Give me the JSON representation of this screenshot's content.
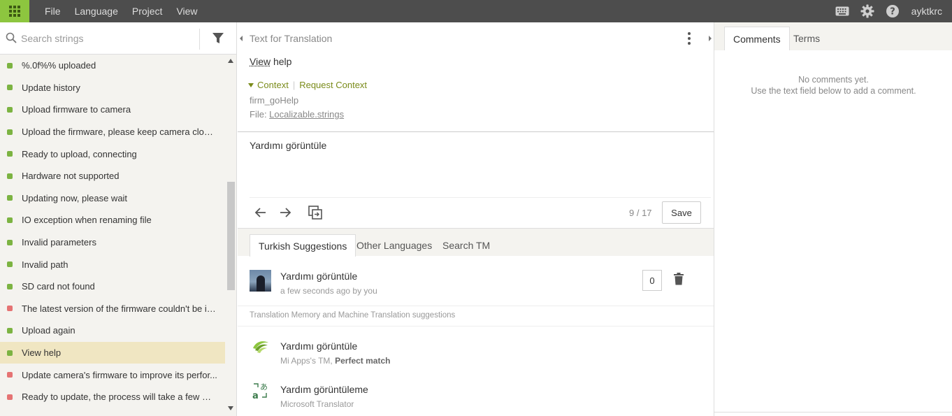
{
  "topbar": {
    "menu": [
      "File",
      "Language",
      "Project",
      "View"
    ],
    "user": "ayktkrc",
    "icons": [
      "apps-grid-icon",
      "keyboard-icon",
      "gear-icon",
      "help-icon"
    ]
  },
  "search": {
    "placeholder": "Search strings"
  },
  "strings": [
    {
      "label": "%.0f%% uploaded",
      "status": "translated"
    },
    {
      "label": "Update history",
      "status": "translated"
    },
    {
      "label": "Upload firmware to camera",
      "status": "translated"
    },
    {
      "label": "Upload the firmware, please keep camera close t...",
      "status": "translated"
    },
    {
      "label": "Ready to upload, connecting",
      "status": "translated"
    },
    {
      "label": "Hardware not supported",
      "status": "translated"
    },
    {
      "label": "Updating now, please wait",
      "status": "translated"
    },
    {
      "label": "IO exception when renaming file",
      "status": "translated"
    },
    {
      "label": "Invalid parameters",
      "status": "translated"
    },
    {
      "label": "Invalid path",
      "status": "translated"
    },
    {
      "label": "SD card not found",
      "status": "translated"
    },
    {
      "label": "The latest version of the firmware couldn't be inst...",
      "status": "untranslated"
    },
    {
      "label": "Upload again",
      "status": "translated"
    },
    {
      "label": "View help",
      "status": "translated"
    },
    {
      "label": "Update camera's firmware to improve its perfor...",
      "status": "untranslated"
    },
    {
      "label": "Ready to update, the process will take a few minu...",
      "status": "untranslated"
    }
  ],
  "editor": {
    "header": "Text for Translation",
    "source_word1": "View",
    "source_word2": " help",
    "context_label": "Context",
    "request_context": "Request Context",
    "key": "firm_goHelp",
    "file_label": "File: ",
    "file_name": "Localizable.strings",
    "translation": "Yardımı görüntüle",
    "counter": "9 / 17",
    "save": "Save"
  },
  "suggestion_tabs": [
    "Turkish Suggestions",
    "Other Languages",
    "Search TM"
  ],
  "suggestion": {
    "text": "Yardımı görüntüle",
    "meta": "a few seconds ago by you",
    "votes": "0"
  },
  "tm": {
    "heading": "Translation Memory and Machine Translation suggestions",
    "rows": [
      {
        "text": "Yardımı görüntüle",
        "source": "Mi Apps's TM, ",
        "match": "Perfect match"
      },
      {
        "text": "Yardım görüntüleme",
        "source": "Microsoft Translator",
        "match": ""
      }
    ]
  },
  "right": {
    "tabs": [
      "Comments",
      "Terms"
    ],
    "empty_line1": "No comments yet.",
    "empty_line2": "Use the text field below to add a comment."
  },
  "colors": {
    "topbar": "#4d4d4d",
    "brand_green": "#8dc63f",
    "translated": "#7cb342",
    "untranslated": "#e57373",
    "active_row": "#f0e6c2",
    "context_link": "#7a8b1a"
  }
}
